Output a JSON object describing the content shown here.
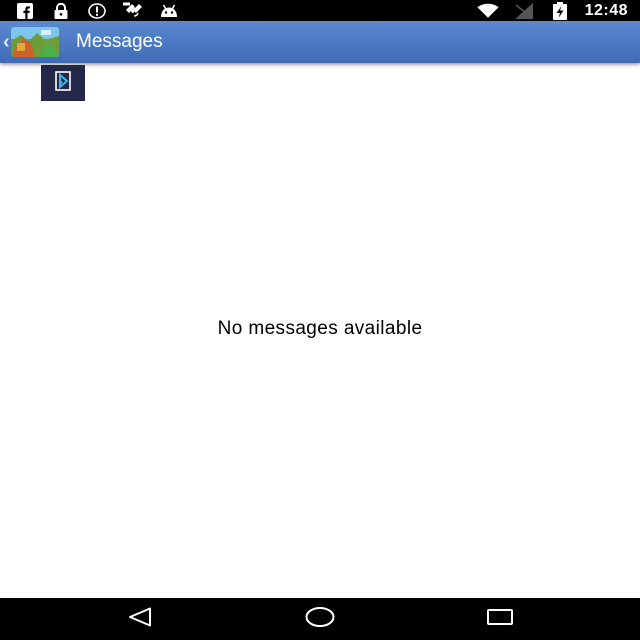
{
  "status_bar": {
    "time": "12:48",
    "left_icons": [
      "facebook-icon",
      "lock-icon",
      "circle-info-icon",
      "satellite-icon",
      "android-icon"
    ],
    "right_icons": [
      "wifi-icon",
      "signal-icon",
      "battery-charging-icon"
    ]
  },
  "action_bar": {
    "title": "Messages",
    "up_icon": "back-chevron-icon",
    "logo_icon": "app-logo-icon",
    "background_color": "#4a78c4"
  },
  "ad_badge": {
    "icon": "ad-choices-icon",
    "background_color": "#23284a"
  },
  "main": {
    "empty_text": "No messages available"
  },
  "nav_bar": {
    "buttons": [
      "back-triangle-icon",
      "home-circle-icon",
      "recents-square-icon"
    ]
  }
}
